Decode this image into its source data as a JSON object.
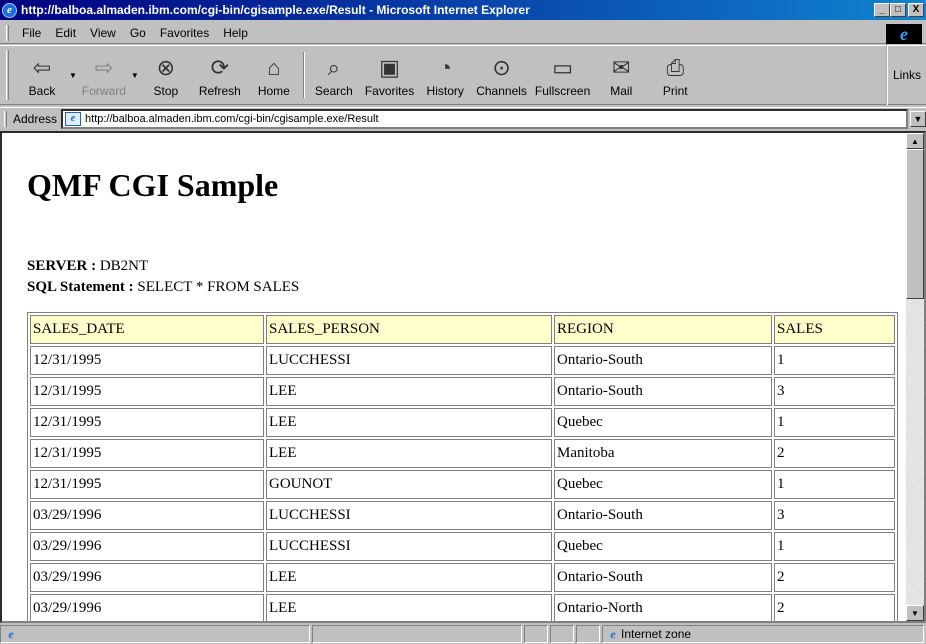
{
  "window": {
    "title": "http://balboa.almaden.ibm.com/cgi-bin/cgisample.exe/Result - Microsoft Internet Explorer",
    "minimize": "_",
    "maximize": "□",
    "close": "X"
  },
  "menu": {
    "items": [
      "File",
      "Edit",
      "View",
      "Go",
      "Favorites",
      "Help"
    ]
  },
  "toolbar": {
    "back": "Back",
    "forward": "Forward",
    "stop": "Stop",
    "refresh": "Refresh",
    "home": "Home",
    "search": "Search",
    "favorites": "Favorites",
    "history": "History",
    "channels": "Channels",
    "fullscreen": "Fullscreen",
    "mail": "Mail",
    "print": "Print",
    "links": "Links"
  },
  "address": {
    "label": "Address",
    "url": "http://balboa.almaden.ibm.com/cgi-bin/cgisample.exe/Result"
  },
  "page": {
    "heading": "QMF CGI Sample",
    "server_label": "SERVER :",
    "server_value": "DB2NT",
    "sql_label": "SQL Statement :",
    "sql_value": "SELECT * FROM SALES"
  },
  "table": {
    "headers": [
      "SALES_DATE",
      "SALES_PERSON",
      "REGION",
      "SALES"
    ],
    "rows": [
      [
        "12/31/1995",
        "LUCCHESSI",
        "Ontario-South",
        "1"
      ],
      [
        "12/31/1995",
        "LEE",
        "Ontario-South",
        "3"
      ],
      [
        "12/31/1995",
        "LEE",
        "Quebec",
        "1"
      ],
      [
        "12/31/1995",
        "LEE",
        "Manitoba",
        "2"
      ],
      [
        "12/31/1995",
        "GOUNOT",
        "Quebec",
        "1"
      ],
      [
        "03/29/1996",
        "LUCCHESSI",
        "Ontario-South",
        "3"
      ],
      [
        "03/29/1996",
        "LUCCHESSI",
        "Quebec",
        "1"
      ],
      [
        "03/29/1996",
        "LEE",
        "Ontario-South",
        "2"
      ],
      [
        "03/29/1996",
        "LEE",
        "Ontario-North",
        "2"
      ]
    ]
  },
  "status": {
    "zone": "Internet zone"
  }
}
